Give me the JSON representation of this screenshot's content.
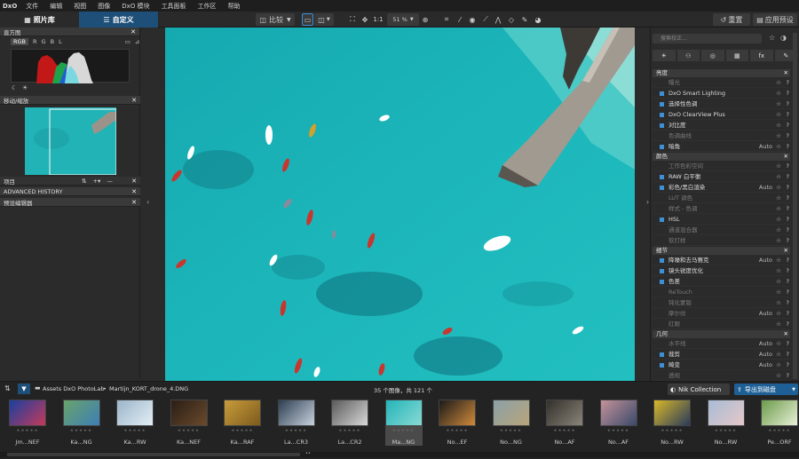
{
  "menubar": {
    "logo": "DxO",
    "items": [
      "文件",
      "编辑",
      "视图",
      "图像",
      "DxO 模块",
      "工具面板",
      "工作区",
      "帮助"
    ]
  },
  "tabs": {
    "library": "照片库",
    "customize": "自定义"
  },
  "toolbar": {
    "compare": "比较",
    "ratio": "1:1",
    "zoom": "51 %",
    "reset": "重置",
    "apply_preset": "应用预设"
  },
  "left_panel": {
    "histogram_title": "直方图",
    "histo_tabs": [
      "RGB",
      "R",
      "G",
      "B",
      "L"
    ],
    "navigator_title": "移动/缩放",
    "project_title": "项目",
    "advanced_history_title": "ADVANCED HISTORY",
    "preset_editor_title": "预设编辑器"
  },
  "right_panel": {
    "search_placeholder": "搜索校正...",
    "palette_tabs": [
      "☀",
      "⚇",
      "◎",
      "▦",
      "fx",
      "✎"
    ],
    "sections": [
      {
        "title": "亮度",
        "rows": [
          {
            "label": "曝光",
            "active": false,
            "auto": ""
          },
          {
            "label": "DxO Smart Lighting",
            "active": true,
            "auto": ""
          },
          {
            "label": "选择性色调",
            "active": true,
            "auto": ""
          },
          {
            "label": "DxO ClearView Plus",
            "active": true,
            "auto": ""
          },
          {
            "label": "对比度",
            "active": true,
            "auto": ""
          },
          {
            "label": "色调曲线",
            "active": false,
            "auto": ""
          },
          {
            "label": "暗角",
            "active": true,
            "auto": "Auto"
          }
        ]
      },
      {
        "title": "颜色",
        "rows": [
          {
            "label": "工作色彩空间",
            "active": false,
            "auto": ""
          },
          {
            "label": "RAW 白平衡",
            "active": true,
            "auto": ""
          },
          {
            "label": "彩色/黑白渲染",
            "active": true,
            "auto": "Auto"
          },
          {
            "label": "LUT 调色",
            "active": false,
            "auto": ""
          },
          {
            "label": "样式 - 色调",
            "active": false,
            "auto": ""
          },
          {
            "label": "HSL",
            "active": true,
            "auto": ""
          },
          {
            "label": "通道混合器",
            "active": false,
            "auto": ""
          },
          {
            "label": "软打样",
            "active": false,
            "auto": ""
          }
        ]
      },
      {
        "title": "细节",
        "rows": [
          {
            "label": "降噪和去马赛克",
            "active": true,
            "auto": "Auto"
          },
          {
            "label": "镜头锐度优化",
            "active": true,
            "auto": ""
          },
          {
            "label": "色差",
            "active": true,
            "auto": ""
          },
          {
            "label": "ReTouch",
            "active": false,
            "auto": ""
          },
          {
            "label": "钝化蒙版",
            "active": false,
            "auto": ""
          },
          {
            "label": "摩尔纹",
            "active": false,
            "auto": "Auto"
          },
          {
            "label": "红眼",
            "active": false,
            "auto": ""
          }
        ]
      },
      {
        "title": "几何",
        "rows": [
          {
            "label": "水平线",
            "active": false,
            "auto": "Auto"
          },
          {
            "label": "裁剪",
            "active": true,
            "auto": "Auto"
          },
          {
            "label": "畸变",
            "active": true,
            "auto": "Auto"
          },
          {
            "label": "透视",
            "active": false,
            "auto": ""
          }
        ]
      }
    ],
    "star": "☆",
    "help": "?"
  },
  "filmstrip_bar": {
    "folder": "Assets DxO PhotoLab",
    "separator": "•",
    "filename": "Martijn_KORT_drone_4.DNG",
    "count": "35 个图像，共 121 个",
    "nik_collection": "Nik Collection",
    "export": "导出到磁盘"
  },
  "filmstrip": {
    "items": [
      {
        "name": "Jm...NEF",
        "c1": "#1a3fa0",
        "c2": "#c43a5a"
      },
      {
        "name": "Ka...NG",
        "c1": "#6aa36b",
        "c2": "#3d7fb5"
      },
      {
        "name": "Ka...RW",
        "c1": "#9bb5c9",
        "c2": "#e3eef5"
      },
      {
        "name": "Ka...NEF",
        "c1": "#2a1e16",
        "c2": "#6b4a2c"
      },
      {
        "name": "Ka...RAF",
        "c1": "#c99d3a",
        "c2": "#7d5a1e"
      },
      {
        "name": "La...CR3",
        "c1": "#2c3e52",
        "c2": "#c8d2dc"
      },
      {
        "name": "La...CR2",
        "c1": "#5a5a5a",
        "c2": "#d8d8d8"
      },
      {
        "name": "Ma...NG",
        "c1": "#23b5b8",
        "c2": "#8ad9d5"
      },
      {
        "name": "No...EF",
        "c1": "#1a1a1a",
        "c2": "#d08a3a"
      },
      {
        "name": "No...NG",
        "c1": "#8aa0a8",
        "c2": "#b9a57a"
      },
      {
        "name": "No...AF",
        "c1": "#33302c",
        "c2": "#8a8478"
      },
      {
        "name": "No...AF",
        "c1": "#c4929a",
        "c2": "#3a4a6a"
      },
      {
        "name": "No...RW",
        "c1": "#d8b82a",
        "c2": "#2a3a5a"
      },
      {
        "name": "No...RW",
        "c1": "#a8bcd6",
        "c2": "#e4c8c8"
      },
      {
        "name": "Pe...ORF",
        "c1": "#6c9b4a",
        "c2": "#e8f0d8"
      }
    ],
    "selected_index": 7,
    "stars": "★★★★★"
  }
}
